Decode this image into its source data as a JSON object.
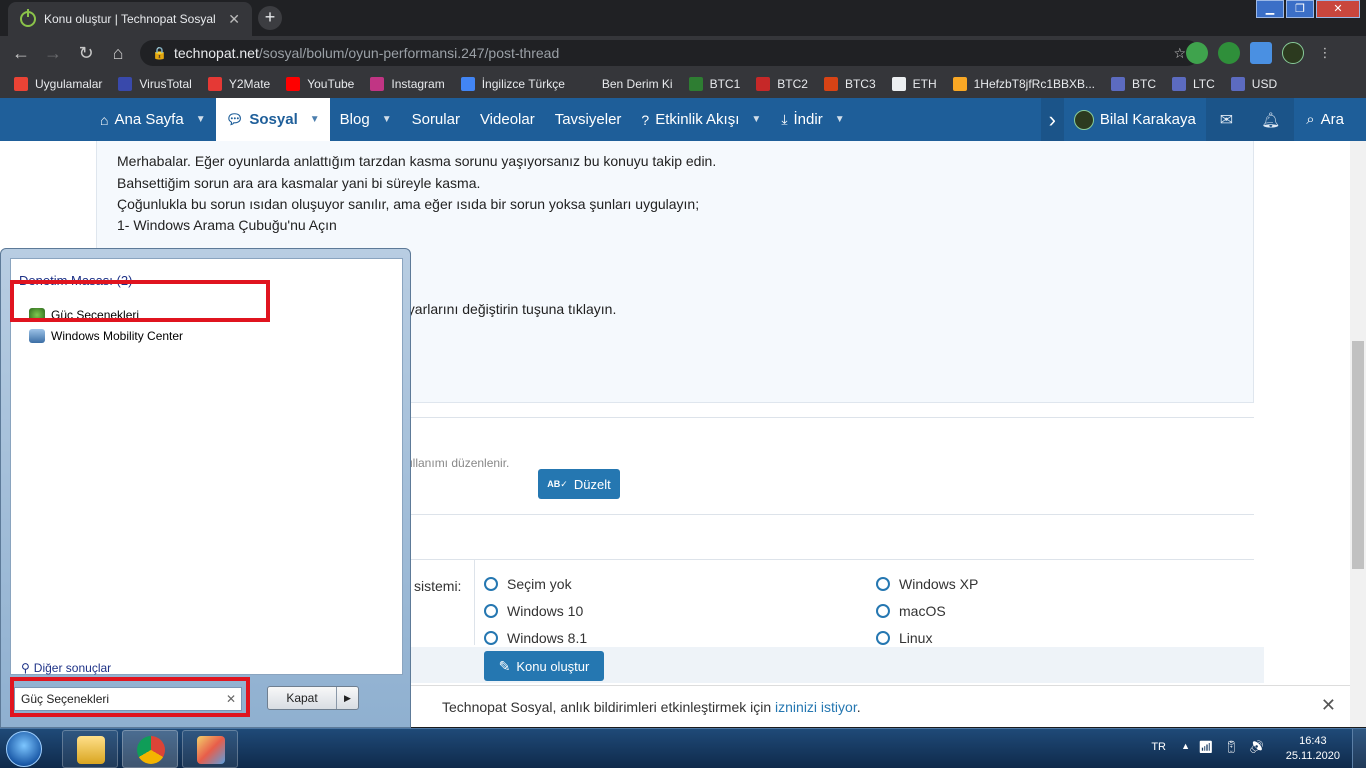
{
  "browser": {
    "tab_title": "Konu oluştur | Technopat Sosyal",
    "tab_close": "✕",
    "new_tab": "+",
    "url_host": "technopat.net",
    "url_path": "/sosyal/bolum/oyun-performansi.247/post-thread",
    "bookmarks": [
      {
        "label": "Uygulamalar",
        "color": "#ea4335"
      },
      {
        "label": "VirusTotal",
        "color": "#3949ab"
      },
      {
        "label": "Y2Mate",
        "color": "#e53935"
      },
      {
        "label": "YouTube",
        "color": "#ff0000"
      },
      {
        "label": "Instagram",
        "color": "#c13584"
      },
      {
        "label": "İngilizce Türkçe",
        "color": "#4285f4"
      },
      {
        "label": "Ben Derim Ki",
        "color": "#35363a"
      },
      {
        "label": "BTC1",
        "color": "#2e7d32"
      },
      {
        "label": "BTC2",
        "color": "#c62828"
      },
      {
        "label": "BTC3",
        "color": "#d84315"
      },
      {
        "label": "ETH",
        "color": "#eceff1"
      },
      {
        "label": "1HefzbT8jfRc1BBXB...",
        "color": "#f9a825"
      },
      {
        "label": "BTC",
        "color": "#5c6bc0"
      },
      {
        "label": "LTC",
        "color": "#5c6bc0"
      },
      {
        "label": "USD",
        "color": "#5c6bc0"
      }
    ]
  },
  "site_nav": {
    "items": [
      {
        "label": "Ana Sayfa",
        "icon": "home-icon",
        "caret": true,
        "active": false
      },
      {
        "label": "Sosyal",
        "icon": "chat-icon",
        "caret": true,
        "active": true
      },
      {
        "label": "Blog",
        "icon": "",
        "caret": true,
        "active": false
      },
      {
        "label": "Sorular",
        "icon": "",
        "caret": false,
        "active": false
      },
      {
        "label": "Videolar",
        "icon": "",
        "caret": false,
        "active": false
      },
      {
        "label": "Tavsiyeler",
        "icon": "",
        "caret": false,
        "active": false
      },
      {
        "label": "Etkinlik Akışı",
        "icon": "question-icon",
        "caret": true,
        "active": false
      },
      {
        "label": "İndir",
        "icon": "download-icon",
        "caret": true,
        "active": false
      }
    ],
    "user_name": "Bilal Karakaya",
    "search_label": "Ara"
  },
  "editor": {
    "lines": [
      "Merhabalar. Eğer oyunlarda anlattığım tarzdan kasma sorunu yaşıyorsanız bu konuyu takip edin.",
      "Bahsettiğim sorun ara ara kasmalar yani bi süreyle kasma.",
      "Çoğunlukla bu sorun ısıdan oluşuyor sanılır, ama eğer ısıda bir sorun yoksa şunları uygulayın;",
      "1- Windows Arama Çubuğu'nu Açın"
    ],
    "partial_line": "ayarlarını değiştirin tuşuna tıklayın."
  },
  "tag_hint": "kullanımı düzenlenir.",
  "duzelt_label": "Düzelt",
  "os_label": "sistemi:",
  "os_options_left": [
    "Seçim yok",
    "Windows 10",
    "Windows 8.1"
  ],
  "os_options_right": [
    "Windows XP",
    "macOS",
    "Linux"
  ],
  "submit_label": "Konu oluştur",
  "notification": {
    "text": "Technopat Sosyal, anlık bildirimleri etkinleştirmek için",
    "link": "izninizi istiyor",
    "end": "."
  },
  "start_menu": {
    "category": "Denetim Masası (2)",
    "results": [
      "Güç Seçenekleri",
      "Windows Mobility Center"
    ],
    "more_results": "Diğer sonuçlar",
    "search_value": "Güç Seçenekleri",
    "shutdown_label": "Kapat"
  },
  "taskbar": {
    "lang": "TR",
    "time": "16:43",
    "date": "25.11.2020"
  },
  "colors": {
    "accent": "#2577b1",
    "nav": "#1f5f9a",
    "highlight": "#e0141f"
  }
}
